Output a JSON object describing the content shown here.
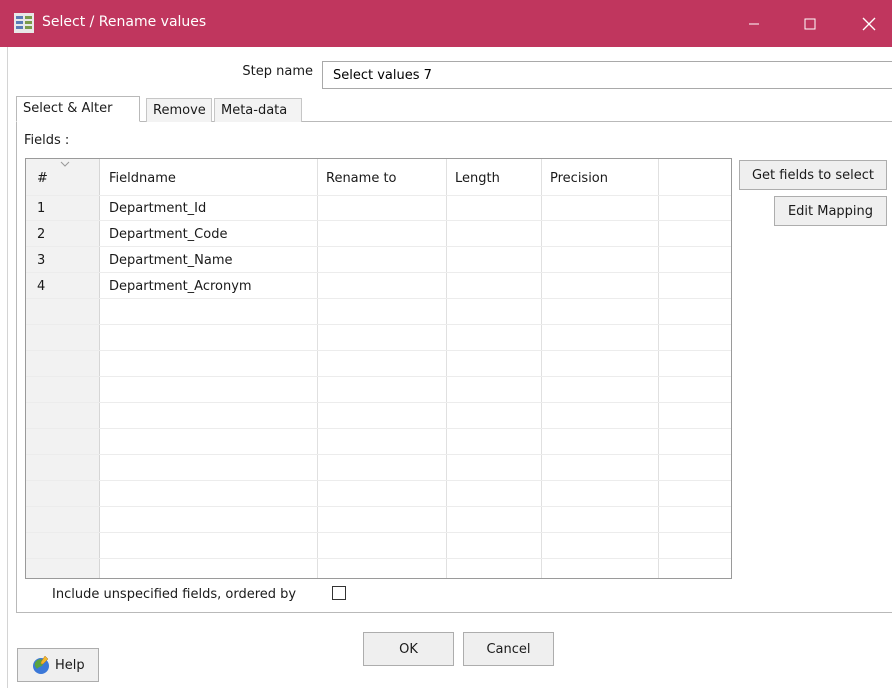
{
  "window": {
    "title": "Select / Rename values"
  },
  "step": {
    "label": "Step name",
    "value": "Select values 7"
  },
  "tabs": [
    {
      "label": "Select & Alter"
    },
    {
      "label": "Remove"
    },
    {
      "label": "Meta-data"
    }
  ],
  "fields": {
    "label": "Fields :",
    "columns": [
      "#",
      "Fieldname",
      "Rename to",
      "Length",
      "Precision"
    ],
    "rows": [
      {
        "num": "1",
        "fieldname": "Department_Id"
      },
      {
        "num": "2",
        "fieldname": "Department_Code"
      },
      {
        "num": "3",
        "fieldname": "Department_Name"
      },
      {
        "num": "4",
        "fieldname": "Department_Acronym"
      }
    ]
  },
  "buttons": {
    "get_fields": "Get fields to select",
    "edit_mapping": "Edit Mapping",
    "ok": "OK",
    "cancel": "Cancel",
    "help": "Help"
  },
  "include": {
    "label": "Include unspecified fields, ordered by",
    "checked": false
  },
  "colors": {
    "titlebar": "#c0365e"
  }
}
